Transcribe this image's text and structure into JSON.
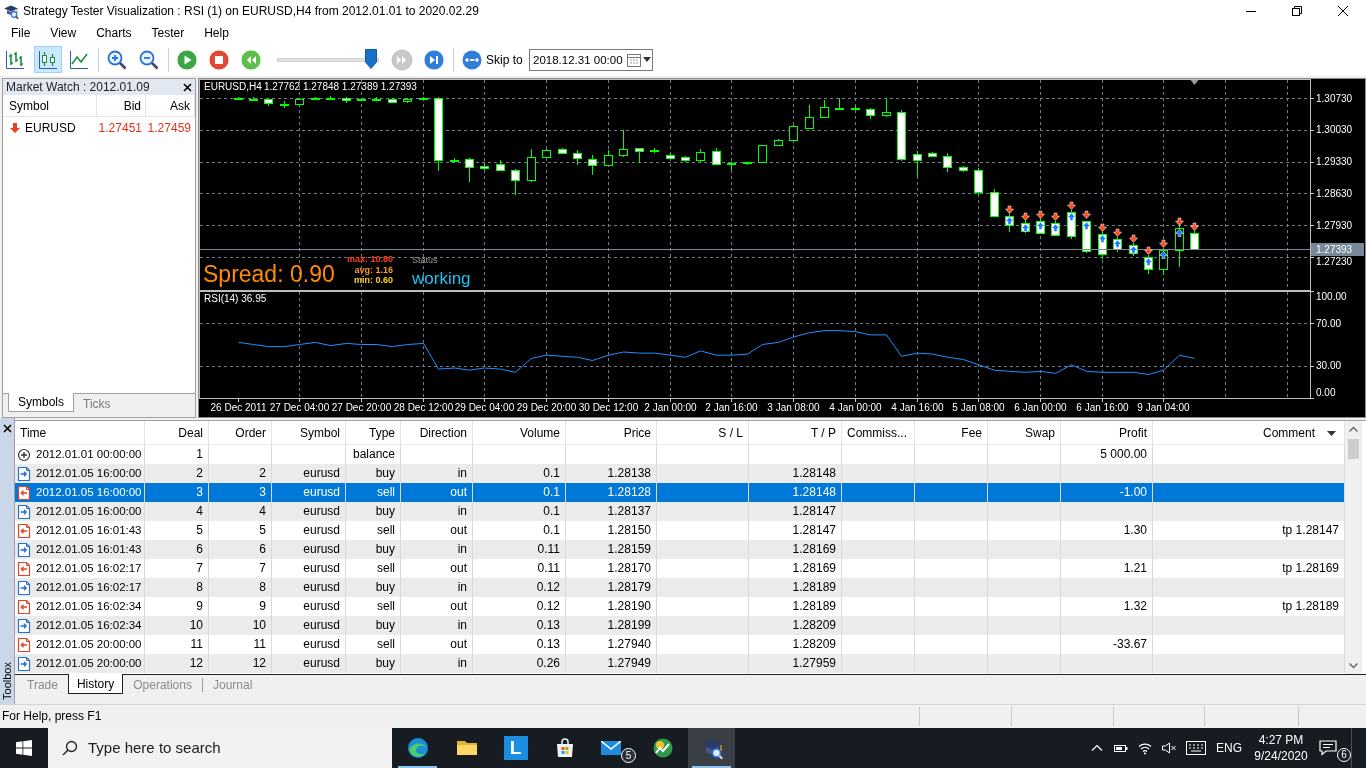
{
  "window": {
    "title": "Strategy Tester Visualization : RSI (1) on EURUSD,H4 from 2012.01.01 to 2020.02.29",
    "menu": [
      "File",
      "View",
      "Charts",
      "Tester",
      "Help"
    ]
  },
  "toolbar": {
    "chart_modes": [
      {
        "kind": "bars",
        "selected": false
      },
      {
        "kind": "candles",
        "selected": true
      },
      {
        "kind": "line",
        "selected": false
      }
    ],
    "playback": [
      {
        "kind": "play",
        "disabled": false
      },
      {
        "kind": "stop",
        "disabled": false
      },
      {
        "kind": "slower",
        "disabled": false
      }
    ],
    "speed": {
      "level": 0.93
    },
    "stepping": [
      {
        "kind": "faster",
        "disabled": true
      },
      {
        "kind": "step",
        "disabled": false
      }
    ],
    "skip_to": {
      "label": "Skip to",
      "value": "2018.12.31 00:00"
    }
  },
  "market_watch": {
    "title": "Market Watch : 2012.01.09",
    "columns": [
      "Symbol",
      "Bid",
      "Ask"
    ],
    "rows": [
      {
        "symbol": "EURUSD",
        "bid": "1.27451",
        "ask": "1.27459",
        "down": true
      }
    ],
    "tabs": [
      {
        "label": "Symbols",
        "selected": true
      },
      {
        "label": "Ticks",
        "selected": false
      }
    ]
  },
  "chart": {
    "overlay": {
      "spread": "Spread: 0.90",
      "stats": [
        {
          "text": "max: 10.80",
          "color": "#ff3b1f"
        },
        {
          "text": "avg: 1.16",
          "color": "#ff9a1a"
        },
        {
          "text": "min: 0.60",
          "color": "#ffd21a"
        }
      ],
      "status_label": "Status",
      "status": "working"
    },
    "chart_data": [
      {
        "type": "candlestick",
        "title": "EURUSD,H4",
        "subtitle": "1.27762 1.27848 1.27389 1.27393",
        "categories": [
          null,
          null,
          null,
          null,
          null,
          null,
          null,
          null,
          null,
          null,
          null,
          null,
          null,
          null,
          null,
          null,
          null,
          null,
          null,
          null,
          null,
          null,
          null,
          null,
          null,
          null,
          null,
          null,
          null,
          null,
          null,
          null,
          null,
          null,
          null,
          null,
          null,
          null,
          null,
          null,
          null,
          null,
          null,
          null,
          null,
          null,
          null,
          null,
          null,
          null,
          null,
          null,
          null,
          null,
          null,
          null,
          null,
          null,
          null,
          null,
          null,
          null,
          null,
          null,
          null,
          null,
          null,
          null,
          null,
          null,
          null,
          null
        ],
        "ohlc": [
          null,
          null,
          [
            1.3074,
            1.3076,
            1.307,
            1.3072
          ],
          [
            1.3072,
            1.3075,
            1.3066,
            1.3069
          ],
          [
            1.307,
            1.3072,
            1.3055,
            1.3062
          ],
          [
            1.3061,
            1.3066,
            1.3052,
            1.306
          ],
          [
            1.306,
            1.3074,
            1.3058,
            1.3071
          ],
          [
            1.3071,
            1.3076,
            1.3068,
            1.3074
          ],
          [
            1.3074,
            1.3077,
            1.307,
            1.3073
          ],
          [
            1.3074,
            1.3076,
            1.3063,
            1.3068
          ],
          [
            1.3071,
            1.3074,
            1.3068,
            1.3072
          ],
          [
            1.3072,
            1.3075,
            1.3068,
            1.3071
          ],
          [
            1.3071,
            1.3073,
            1.3062,
            1.3065
          ],
          [
            1.3066,
            1.3073,
            1.3063,
            1.307
          ],
          [
            1.3071,
            1.3076,
            1.3068,
            1.3073
          ],
          [
            1.3073,
            1.3075,
            1.2912,
            1.2937
          ],
          [
            1.2937,
            1.2942,
            1.2932,
            1.2936
          ],
          [
            1.2938,
            1.294,
            1.2889,
            1.2922
          ],
          [
            1.2923,
            1.2929,
            1.2914,
            1.2919
          ],
          [
            1.2928,
            1.2936,
            1.2914,
            1.2915
          ],
          [
            1.2915,
            1.2917,
            1.286,
            1.2892
          ],
          [
            1.2892,
            1.2961,
            1.2889,
            1.2944
          ],
          [
            1.2944,
            1.296,
            1.2942,
            1.2959
          ],
          [
            1.2961,
            1.2964,
            1.2952,
            1.2953
          ],
          [
            1.2952,
            1.2958,
            1.2925,
            1.2942
          ],
          [
            1.2938,
            1.2947,
            1.2904,
            1.2925
          ],
          [
            1.2925,
            1.2958,
            1.2923,
            1.2948
          ],
          [
            1.2948,
            1.3003,
            1.2944,
            1.296
          ],
          [
            1.2962,
            1.2964,
            1.293,
            1.2956
          ],
          [
            1.2958,
            1.2962,
            1.2953,
            1.2956
          ],
          [
            1.2948,
            1.2951,
            1.2939,
            1.2941
          ],
          [
            1.2943,
            1.2946,
            1.2933,
            1.2936
          ],
          [
            1.2936,
            1.296,
            1.2933,
            1.2955
          ],
          [
            1.2957,
            1.2963,
            1.2925,
            1.2927
          ],
          [
            1.2929,
            1.2931,
            1.2915,
            1.2928
          ],
          [
            1.2929,
            1.2933,
            1.2926,
            1.2932
          ],
          [
            1.2933,
            1.297,
            1.2932,
            1.2969
          ],
          [
            1.297,
            1.2982,
            1.2968,
            1.298
          ],
          [
            1.298,
            1.3014,
            1.2978,
            1.3011
          ],
          [
            1.3008,
            1.3057,
            1.3007,
            1.3032
          ],
          [
            1.3031,
            1.3068,
            1.3029,
            1.3053
          ],
          [
            1.3052,
            1.3073,
            1.3049,
            1.3051
          ],
          [
            1.3052,
            1.3055,
            1.3047,
            1.305
          ],
          [
            1.3049,
            1.3052,
            1.3027,
            1.3035
          ],
          [
            1.3035,
            1.3073,
            1.3032,
            1.3042
          ],
          [
            1.3043,
            1.3046,
            1.2935,
            1.2938
          ],
          [
            1.295,
            1.2956,
            1.2899,
            1.2937
          ],
          [
            1.2952,
            1.2955,
            1.2945,
            1.2946
          ],
          [
            1.2945,
            1.2951,
            1.2909,
            1.2922
          ],
          [
            1.2921,
            1.2924,
            1.2911,
            1.2914
          ],
          [
            1.2915,
            1.2918,
            1.286,
            1.2866
          ],
          [
            1.2867,
            1.2873,
            1.281,
            1.2814
          ],
          [
            1.2814,
            1.282,
            1.2777,
            1.2794
          ],
          [
            1.2797,
            1.2805,
            1.2775,
            1.2779
          ],
          [
            1.2801,
            1.2806,
            1.2775,
            1.2776
          ],
          [
            1.2798,
            1.2803,
            1.277,
            1.2772
          ],
          [
            1.2822,
            1.2826,
            1.2762,
            1.2768
          ],
          [
            1.2801,
            1.2803,
            1.2731,
            1.2736
          ],
          [
            1.2773,
            1.2778,
            1.2718,
            1.2729
          ],
          [
            1.2762,
            1.2766,
            1.2734,
            1.274
          ],
          [
            1.275,
            1.2754,
            1.2726,
            1.2732
          ],
          [
            1.2722,
            1.2727,
            1.2685,
            1.2697
          ],
          [
            1.2697,
            1.2742,
            1.2684,
            1.2738
          ],
          [
            1.2738,
            1.2792,
            1.27,
            1.2786
          ],
          [
            1.27762,
            1.27848,
            1.27389,
            1.27393
          ],
          null,
          null,
          null,
          null,
          null,
          null,
          null
        ],
        "ylim": [
          1.265,
          1.3115
        ],
        "yticks": [
          {
            "value": 1.3073,
            "label": "1.30730"
          },
          {
            "value": 1.3003,
            "label": "1.30030"
          },
          {
            "value": 1.2933,
            "label": "1.29330"
          },
          {
            "value": 1.2863,
            "label": "1.28630"
          },
          {
            "value": 1.2793,
            "label": "1.27930"
          },
          {
            "value": 1.2723,
            "label": "1.27230"
          }
        ],
        "tick_labels": "y",
        "grid": true,
        "ref_lines": [
          {
            "axis": "y",
            "value": 1.27393,
            "label": "1.27393",
            "color": "#778899"
          }
        ]
      },
      {
        "type": "line",
        "title": "RSI(14) 36.95",
        "categories": [
          null,
          null,
          "26 Dec 2011",
          null,
          null,
          null,
          "27 Dec 04:00",
          null,
          null,
          null,
          "27 Dec 20:00",
          null,
          null,
          null,
          "28 Dec 12:00",
          null,
          null,
          null,
          "29 Dec 04:00",
          null,
          null,
          null,
          "29 Dec 20:00",
          null,
          null,
          null,
          "30 Dec 12:00",
          null,
          null,
          null,
          "2 Jan 00:00",
          null,
          null,
          null,
          "2 Jan 16:00",
          null,
          null,
          null,
          "3 Jan 08:00",
          null,
          null,
          null,
          "4 Jan 00:00",
          null,
          null,
          null,
          "4 Jan 16:00",
          null,
          null,
          null,
          "5 Jan 08:00",
          null,
          null,
          null,
          "6 Jan 00:00",
          null,
          null,
          null,
          "6 Jan 16:00",
          null,
          null,
          null,
          "9 Jan 04:00",
          null,
          null,
          null,
          null,
          null,
          null,
          null,
          null,
          null
        ],
        "values": [
          null,
          null,
          52,
          50,
          48,
          48,
          50,
          52,
          49,
          51,
          50,
          50,
          48,
          50,
          51,
          27,
          28,
          26,
          28,
          27,
          24,
          37,
          40,
          39,
          38,
          35,
          40,
          43,
          42,
          42,
          40,
          38,
          44,
          40,
          40,
          41,
          50,
          52,
          57,
          61,
          63,
          63,
          62,
          59,
          59,
          39,
          42,
          41,
          38,
          36,
          31,
          26,
          25,
          24,
          25,
          23,
          31,
          25,
          24,
          24,
          24,
          22,
          26,
          40,
          37,
          null,
          null,
          null,
          null,
          null,
          null,
          null
        ],
        "color": "#1e90ff",
        "ylim": [
          0,
          100
        ],
        "yticks": [
          {
            "value": 100,
            "label": "100.00"
          },
          {
            "value": 70,
            "label": "70.00"
          },
          {
            "value": 30,
            "label": "30.00"
          },
          {
            "value": 0,
            "label": "0.00"
          }
        ],
        "grid": true
      }
    ]
  },
  "toolbox": {
    "title": "Toolbox",
    "table": {
      "columns": [
        "Time",
        "Deal",
        "Order",
        "Symbol",
        "Type",
        "Direction",
        "Volume",
        "Price",
        "S / L",
        "T / P",
        "Commiss...",
        "Fee",
        "Swap",
        "Profit",
        "Comment"
      ],
      "rows": [
        {
          "kind": "balance",
          "selected": false,
          "time": "2012.01.01 00:00:00",
          "deal": "1",
          "type": "balance",
          "profit": "5 000.00"
        },
        {
          "kind": "in",
          "selected": false,
          "time": "2012.01.05 16:00:00",
          "deal": "2",
          "order": "2",
          "symbol": "eurusd",
          "type": "buy",
          "direction": "in",
          "volume": "0.1",
          "price": "1.28138",
          "tp": "1.28148"
        },
        {
          "kind": "out",
          "selected": true,
          "time": "2012.01.05 16:00:00",
          "deal": "3",
          "order": "3",
          "symbol": "eurusd",
          "type": "sell",
          "direction": "out",
          "volume": "0.1",
          "price": "1.28128",
          "tp": "1.28148",
          "profit": "-1.00"
        },
        {
          "kind": "in",
          "selected": false,
          "time": "2012.01.05 16:00:00",
          "deal": "4",
          "order": "4",
          "symbol": "eurusd",
          "type": "buy",
          "direction": "in",
          "volume": "0.1",
          "price": "1.28137",
          "tp": "1.28147"
        },
        {
          "kind": "out",
          "selected": false,
          "time": "2012.01.05 16:01:43",
          "deal": "5",
          "order": "5",
          "symbol": "eurusd",
          "type": "sell",
          "direction": "out",
          "volume": "0.1",
          "price": "1.28150",
          "tp": "1.28147",
          "profit": "1.30",
          "comment": "tp 1.28147"
        },
        {
          "kind": "in",
          "selected": false,
          "time": "2012.01.05 16:01:43",
          "deal": "6",
          "order": "6",
          "symbol": "eurusd",
          "type": "buy",
          "direction": "in",
          "volume": "0.11",
          "price": "1.28159",
          "tp": "1.28169"
        },
        {
          "kind": "out",
          "selected": false,
          "time": "2012.01.05 16:02:17",
          "deal": "7",
          "order": "7",
          "symbol": "eurusd",
          "type": "sell",
          "direction": "out",
          "volume": "0.11",
          "price": "1.28170",
          "tp": "1.28169",
          "profit": "1.21",
          "comment": "tp 1.28169"
        },
        {
          "kind": "in",
          "selected": false,
          "time": "2012.01.05 16:02:17",
          "deal": "8",
          "order": "8",
          "symbol": "eurusd",
          "type": "buy",
          "direction": "in",
          "volume": "0.12",
          "price": "1.28179",
          "tp": "1.28189"
        },
        {
          "kind": "out",
          "selected": false,
          "time": "2012.01.05 16:02:34",
          "deal": "9",
          "order": "9",
          "symbol": "eurusd",
          "type": "sell",
          "direction": "out",
          "volume": "0.12",
          "price": "1.28190",
          "tp": "1.28189",
          "profit": "1.32",
          "comment": "tp 1.28189"
        },
        {
          "kind": "in",
          "selected": false,
          "time": "2012.01.05 16:02:34",
          "deal": "10",
          "order": "10",
          "symbol": "eurusd",
          "type": "buy",
          "direction": "in",
          "volume": "0.13",
          "price": "1.28199",
          "tp": "1.28209"
        },
        {
          "kind": "out",
          "selected": false,
          "time": "2012.01.05 20:00:00",
          "deal": "11",
          "order": "11",
          "symbol": "eurusd",
          "type": "sell",
          "direction": "out",
          "volume": "0.13",
          "price": "1.27940",
          "tp": "1.28209",
          "profit": "-33.67"
        },
        {
          "kind": "in",
          "selected": false,
          "time": "2012.01.05 20:00:00",
          "deal": "12",
          "order": "12",
          "symbol": "eurusd",
          "type": "buy",
          "direction": "in",
          "volume": "0.26",
          "price": "1.27949",
          "tp": "1.27959"
        }
      ]
    },
    "tabs": [
      {
        "label": "Trade",
        "selected": false
      },
      {
        "label": "History",
        "selected": true
      },
      {
        "label": "Operations",
        "selected": false
      },
      {
        "label": "Journal",
        "selected": false
      }
    ]
  },
  "status_bar": {
    "text": "For Help, press F1"
  },
  "taskbar": {
    "search": {
      "placeholder": "Type here to search"
    },
    "apps": [
      {
        "kind": "browser",
        "running": true,
        "active": false
      },
      {
        "kind": "folder",
        "running": false,
        "active": false
      },
      {
        "kind": "letter",
        "letter": "L",
        "running": false,
        "active": false
      },
      {
        "kind": "store",
        "running": false,
        "active": false
      },
      {
        "kind": "mail",
        "badge": "5",
        "running": false,
        "active": false
      },
      {
        "kind": "trading",
        "running": false,
        "active": false
      },
      {
        "kind": "tester",
        "running": true,
        "active": true
      }
    ],
    "tray": {
      "language": "ENG",
      "time": "4:27 PM",
      "date": "9/24/2020",
      "notification_count": "6"
    }
  }
}
